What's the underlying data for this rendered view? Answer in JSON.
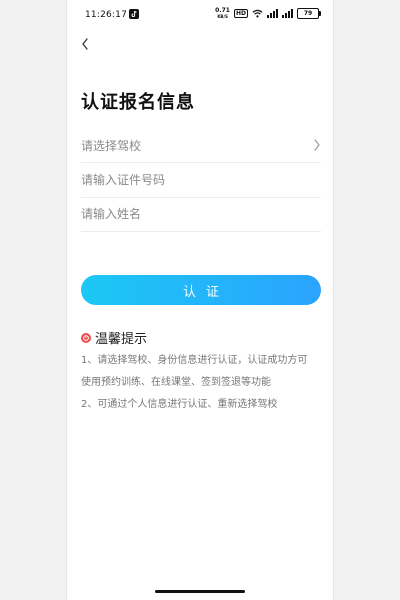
{
  "status_bar": {
    "time": "11:26:17",
    "network_speed_value": "0.71",
    "network_speed_unit": "KB/S",
    "hd_badge": "HD",
    "battery_level": "79"
  },
  "header": {
    "title": "认证报名信息"
  },
  "form": {
    "school_select_label": "请选择驾校",
    "id_number_placeholder": "请输入证件号码",
    "name_placeholder": "请输入姓名",
    "submit_label": "认证"
  },
  "tips": {
    "title": "温馨提示",
    "line1": "1、请选择驾校、身份信息进行认证，认证成功方可",
    "line2": "使用预约训练、在线课堂、签到签退等功能",
    "line3": "2、可通过个人信息进行认证、重新选择驾校"
  },
  "colors": {
    "accent_gradient_start": "#1cc8f4",
    "accent_gradient_end": "#2aa3ff",
    "warning_red": "#f04a4a"
  },
  "icons": [
    "tiktok-icon",
    "wifi-icon",
    "signal-icon",
    "battery-icon",
    "back-arrow-icon",
    "chevron-right-icon",
    "warning-icon"
  ]
}
